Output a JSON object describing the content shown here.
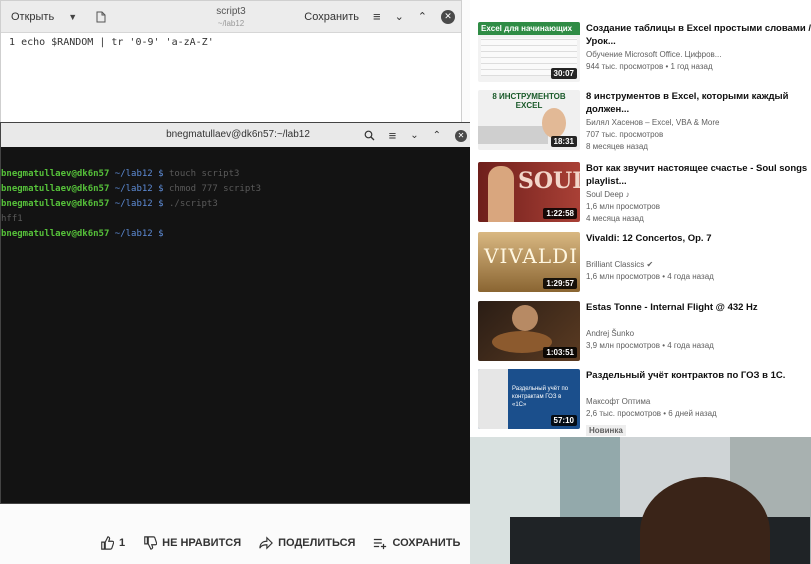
{
  "editor": {
    "open_label": "Открыть",
    "title": "script3",
    "subtitle": "~/lab12",
    "save_label": "Сохранить",
    "line_number": "1",
    "line_text": "echo $RANDOM | tr '0-9' 'a-zA-Z'"
  },
  "terminal": {
    "title": "bnegmatullaev@dk6n57:~/lab12",
    "lines": [
      {
        "user": "bnegmatullaev@dk6n57",
        "path": " ~/lab12 $",
        "cmd": " touch script3"
      },
      {
        "user": "bnegmatullaev@dk6n57",
        "path": " ~/lab12 $",
        "cmd": " chmod 777 script3"
      },
      {
        "user": "bnegmatullaev@dk6n57",
        "path": " ~/lab12 $",
        "cmd": " ./script3"
      },
      {
        "output": "hff1"
      },
      {
        "user": "bnegmatullaev@dk6n57",
        "path": " ~/lab12 $",
        "cmd": ""
      }
    ]
  },
  "videos": [
    {
      "title": "Создание таблицы в Excel простыми словами / Урок...",
      "channel": "Обучение Microsoft Office. Цифров...",
      "meta": "944 тыс. просмотров • 1 год назад",
      "duration": "30:07",
      "thumb_text": "Excel для начинающих",
      "color": "#2f8c45"
    },
    {
      "title": "8 инструментов в Excel, которыми каждый должен...",
      "channel": "Билял Хасенов – Excel, VBA & More",
      "meta": "707 тыс. просмотров",
      "meta2": "8 месяцев назад",
      "duration": "18:31",
      "thumb_text": "8 ИНСТРУМЕНТОВ EXCEL",
      "color": "#e8e8e8"
    },
    {
      "title": "Вот как звучит настоящее счастье - Soul songs playlist...",
      "channel": "Soul Deep ♪",
      "meta": "1,6 млн просмотров",
      "meta2": "4 месяца назад",
      "duration": "1:22:58",
      "thumb_text": "SOUL",
      "color": "#8e2c25"
    },
    {
      "title": "Vivaldi: 12 Concertos, Op. 7",
      "channel": "Brilliant Classics ✔",
      "meta": "1,6 млн просмотров • 4 года назад",
      "duration": "1:29:57",
      "thumb_text": "VIVALDI",
      "color": "#b98e49"
    },
    {
      "title": "Estas Tonne - Internal Flight @ 432 Hz",
      "channel": "Andrej Šunko",
      "meta": "3,9 млн просмотров • 4 года назад",
      "duration": "1:03:51",
      "thumb_text": "",
      "color": "#3e2a1e"
    },
    {
      "title": "Раздельный учёт контрактов по ГОЗ в 1С.",
      "channel": "Максофт Оптима",
      "meta": "2,6 тыс. просмотров • 6 дней назад",
      "duration": "57:10",
      "badge": "Новинка",
      "thumb_text": "Раздельный учёт по контрактам ГОЗ в «1С»",
      "color": "#1b4f8c"
    }
  ],
  "actions": {
    "like_count": "1",
    "dislike": "НЕ НРАВИТСЯ",
    "share": "ПОДЕЛИТЬСЯ",
    "save": "СОХРАНИТЬ",
    "more": "..."
  }
}
